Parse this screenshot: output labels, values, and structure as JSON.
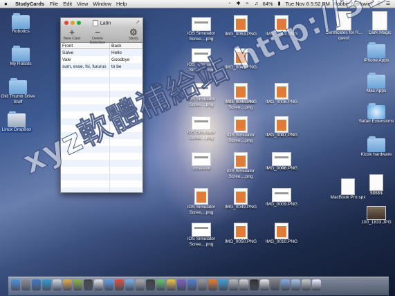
{
  "menubar": {
    "app_name": "StudyCards",
    "menus": [
      "File",
      "Edit",
      "View",
      "Window",
      "Help"
    ],
    "battery": "64%",
    "clock": "Tue Nov 6 5:52 PM",
    "user": "Robbie Markwick"
  },
  "left_icons": [
    {
      "label": "Robotics"
    },
    {
      "label": "My Robots"
    },
    {
      "label": "Old Thumb Drive Stuff"
    },
    {
      "label": "Linux DropBox"
    }
  ],
  "window": {
    "title": "Latin",
    "toolbar": {
      "new_card": "New Card",
      "delete_selection": "Delete Selection",
      "study": "Study"
    },
    "columns": [
      "Front",
      "Back"
    ],
    "rows": [
      [
        "Salve",
        "Hello"
      ],
      [
        "Vale",
        "Goodbye"
      ],
      [
        "sum, esse, fsi, fururus",
        "to be"
      ]
    ]
  },
  "files": [
    {
      "label": "iOS Simulator Scree....png",
      "kind": "sim"
    },
    {
      "label": "IMG_0053.PNG",
      "kind": "orange"
    },
    {
      "label": "IMG_0013.PNG",
      "kind": "orange"
    },
    {
      "label": "Certificates for R... quest",
      "kind": "doc"
    },
    {
      "label": "Dark Magic",
      "kind": "doc"
    },
    {
      "label": "iOS Simulator Scree....png",
      "kind": "sim"
    },
    {
      "label": "IMG_0045.PNG",
      "kind": "orange"
    },
    {
      "label": "iOS Simulator Scree....png",
      "kind": "sim"
    },
    {
      "label": "iOS Simulator Scree....png",
      "kind": "orange"
    },
    {
      "label": "IMG_0046.PNG",
      "kind": "orange"
    },
    {
      "label": "IMG_0006.PNG",
      "kind": "orange"
    },
    {
      "label": "iOS Simulator Scree....png",
      "kind": "sim"
    },
    {
      "label": "iOS Simulator Scree....png",
      "kind": "orange"
    },
    {
      "label": "IMG_0047.PNG",
      "kind": "orange"
    },
    {
      "label": "IMG_0007.PNG",
      "kind": "orange"
    },
    {
      "label": ".localized",
      "kind": "sim"
    },
    {
      "label": "iOS Simulator Scree....png",
      "kind": "orange"
    },
    {
      "label": "IMG_0048.PNG",
      "kind": "sim"
    },
    {
      "label": "IMG_0008.PNG",
      "kind": "sim"
    },
    {
      "label": "iOS Simulator Scree....png",
      "kind": "orange"
    },
    {
      "label": "IMG_0049.PNG",
      "kind": "orange"
    },
    {
      "label": "IMG_0009.PNG",
      "kind": "sim"
    },
    {
      "label": "iOS Simulator Scree....png",
      "kind": "sim"
    },
    {
      "label": "IMG_0050.PNG",
      "kind": "orange"
    },
    {
      "label": "IMG_0010.PNG",
      "kind": "orange"
    }
  ],
  "right_icons": [
    {
      "label": "iPhone Apps"
    },
    {
      "label": "Mac Apps"
    },
    {
      "label": "Safari Extensions"
    },
    {
      "label": "Kiosk hardware"
    },
    {
      "label": "MacBook Pro.spx"
    },
    {
      "label": "$$$$$"
    },
    {
      "label": "100_1833.JPG"
    }
  ],
  "watermark": "xyz軟體補給站 http://31.to"
}
